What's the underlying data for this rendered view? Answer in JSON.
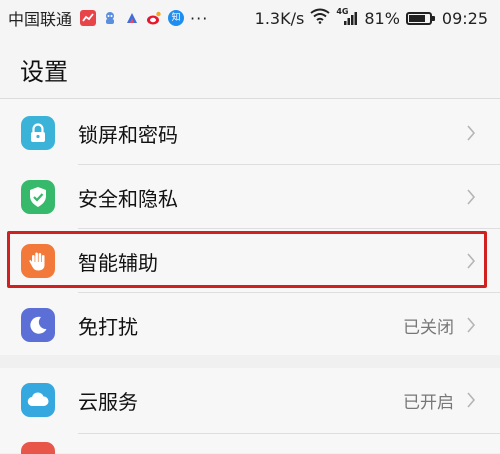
{
  "statusbar": {
    "carrier": "中国联通",
    "dots": "···",
    "speed": "1.3K/s",
    "network": "4G",
    "battery_percent": "81%",
    "battery_level": 0.81,
    "time": "09:25",
    "notif_icons": [
      "stock-app-icon",
      "cloud-app-icon",
      "arrow-app-icon",
      "weibo-app-icon",
      "zhihu-app-icon"
    ],
    "zhihu_label": "知"
  },
  "header": {
    "title": "设置"
  },
  "settings": {
    "items": [
      {
        "label": "锁屏和密码",
        "value": "",
        "icon": "lock-icon",
        "color": "#3bb3d9"
      },
      {
        "label": "安全和隐私",
        "value": "",
        "icon": "shield-check-icon",
        "color": "#37b96b"
      },
      {
        "label": "智能辅助",
        "value": "",
        "icon": "hand-icon",
        "color": "#f2793a"
      },
      {
        "label": "免打扰",
        "value": "已关闭",
        "icon": "moon-icon",
        "color": "#5b6fd6"
      }
    ],
    "items2": [
      {
        "label": "云服务",
        "value": "已开启",
        "icon": "cloud-icon",
        "color": "#36a8e0"
      }
    ]
  },
  "highlight_color": "#d0201f"
}
